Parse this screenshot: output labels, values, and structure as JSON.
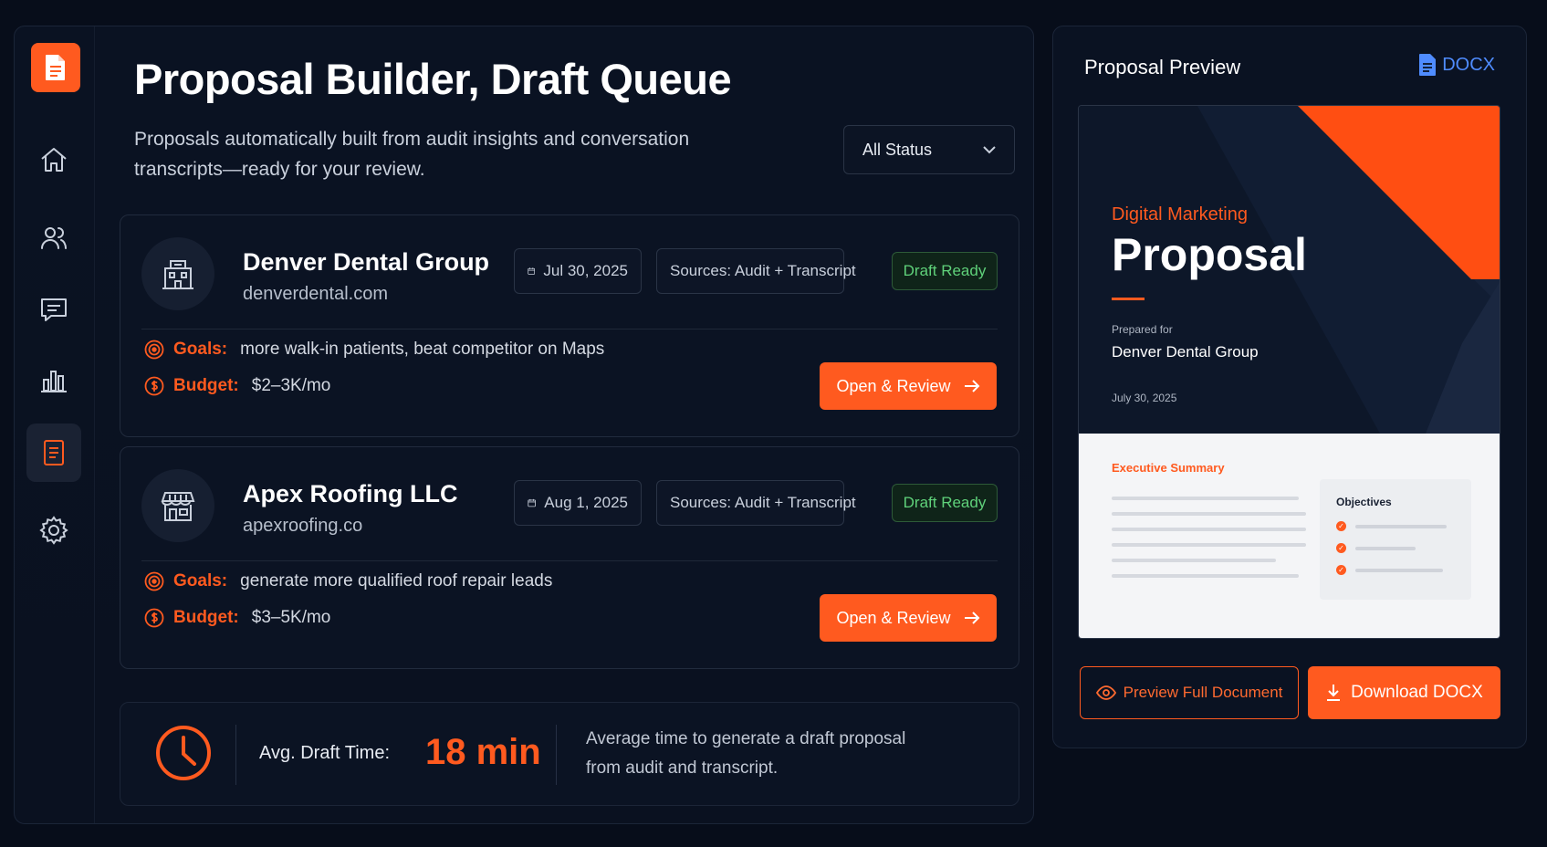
{
  "header": {
    "title": "Proposal Builder, Draft Queue",
    "subtitle": "Proposals automatically built from audit insights and conversation transcripts—ready for your review."
  },
  "filter": {
    "selected": "All Status"
  },
  "sidebar": {
    "items": [
      {
        "name": "home",
        "icon": "home-icon",
        "active": false
      },
      {
        "name": "users",
        "icon": "users-icon",
        "active": false
      },
      {
        "name": "messages",
        "icon": "message-icon",
        "active": false
      },
      {
        "name": "analytics",
        "icon": "bar-chart-icon",
        "active": false
      },
      {
        "name": "proposals",
        "icon": "document-icon",
        "active": true
      },
      {
        "name": "settings",
        "icon": "gear-icon",
        "active": false
      }
    ]
  },
  "proposals": [
    {
      "name": "Denver Dental Group",
      "url": "denverdental.com",
      "date": "Jul 30, 2025",
      "sources": "Sources: Audit + Transcript",
      "status": "Draft Ready",
      "goals_label": "Goals:",
      "goals": "more walk-in patients, beat competitor on Maps",
      "budget_label": "Budget:",
      "budget": "$2–3K/mo",
      "action": "Open & Review"
    },
    {
      "name": "Apex Roofing LLC",
      "url": "apexroofing.co",
      "date": "Aug 1, 2025",
      "sources": "Sources: Audit + Transcript",
      "status": "Draft Ready",
      "goals_label": "Goals:",
      "goals": "generate more qualified roof repair leads",
      "budget_label": "Budget:",
      "budget": "$3–5K/mo",
      "action": "Open & Review"
    }
  ],
  "stats": {
    "label": "Avg. Draft Time:",
    "value": "18 min",
    "description": "Average time to generate a draft proposal from audit and transcript."
  },
  "preview": {
    "title": "Proposal Preview",
    "format_link": "DOCX",
    "cover": {
      "subtitle": "Digital Marketing",
      "title": "Proposal",
      "prepared_for_label": "Prepared for",
      "client": "Denver Dental Group",
      "date": "July 30, 2025"
    },
    "body": {
      "section_title": "Executive Summary",
      "objectives_title": "Objectives"
    },
    "preview_button": "Preview Full Document",
    "download_button": "Download DOCX"
  },
  "colors": {
    "accent": "#ff5a1f",
    "background": "#070d1a",
    "status_green": "#5fd17a",
    "link_blue": "#4f8cff"
  }
}
